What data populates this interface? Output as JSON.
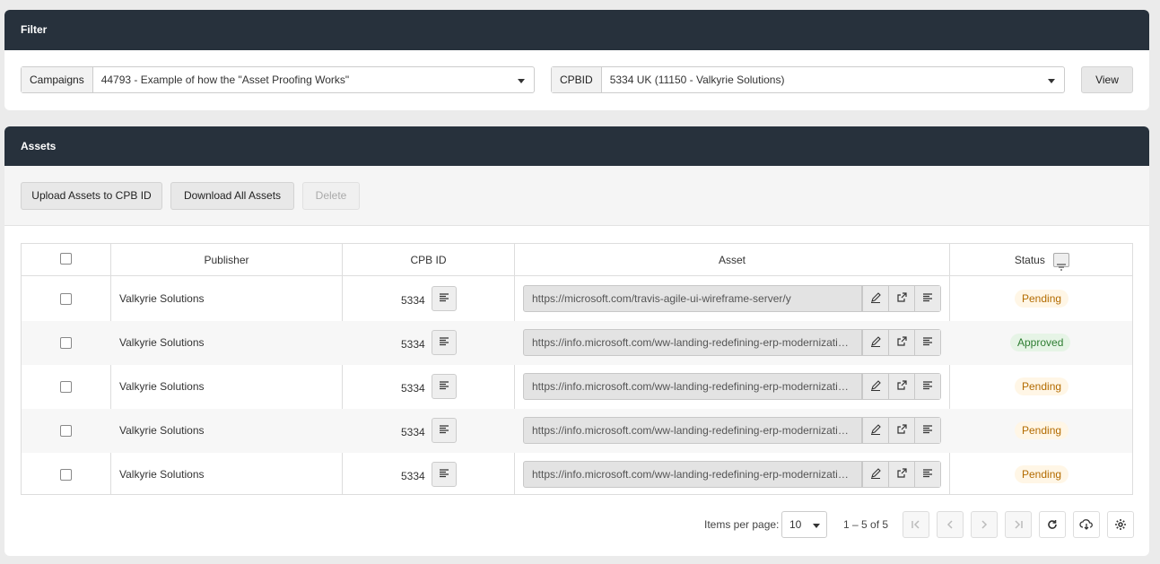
{
  "filter": {
    "title": "Filter",
    "campaigns_label": "Campaigns",
    "campaigns_value": "44793 - Example of how the \"Asset Proofing Works\"",
    "cpbid_label": "CPBID",
    "cpbid_value": "5334 UK (11150 - Valkyrie Solutions)",
    "view_button": "View"
  },
  "assets": {
    "title": "Assets",
    "upload_button": "Upload Assets to CPB ID",
    "download_button": "Download All Assets",
    "delete_button": "Delete",
    "columns": [
      "Publisher",
      "CPB ID",
      "Asset",
      "Status"
    ],
    "rows": [
      {
        "publisher": "Valkyrie Solutions",
        "cpbid": "5334",
        "asset": "https://microsoft.com/travis-agile-ui-wireframe-server/y",
        "status": "Pending"
      },
      {
        "publisher": "Valkyrie Solutions",
        "cpbid": "5334",
        "asset": "https://info.microsoft.com/ww-landing-redefining-erp-modernization.html",
        "status": "Approved"
      },
      {
        "publisher": "Valkyrie Solutions",
        "cpbid": "5334",
        "asset": "https://info.microsoft.com/ww-landing-redefining-erp-modernization.html",
        "status": "Pending"
      },
      {
        "publisher": "Valkyrie Solutions",
        "cpbid": "5334",
        "asset": "https://info.microsoft.com/ww-landing-redefining-erp-modernization.html",
        "status": "Pending"
      },
      {
        "publisher": "Valkyrie Solutions",
        "cpbid": "5334",
        "asset": "https://info.microsoft.com/ww-landing-redefining-erp-modernization.html",
        "status": "Pending"
      }
    ],
    "status_colors": {
      "Pending": "#b36b00",
      "Approved": "#2e7d32"
    }
  },
  "pager": {
    "items_per_page_label": "Items per page:",
    "items_per_page": "10",
    "range": "1 – 5 of 5"
  },
  "icons": [
    "caret-down-icon",
    "filter-icon",
    "list-icon",
    "edit-icon",
    "external-link-icon",
    "first-page-icon",
    "prev-page-icon",
    "next-page-icon",
    "last-page-icon",
    "refresh-icon",
    "cloud-download-icon",
    "gear-icon"
  ],
  "colors": {
    "header": "#27313c",
    "page_bg": "#ebebeb"
  }
}
